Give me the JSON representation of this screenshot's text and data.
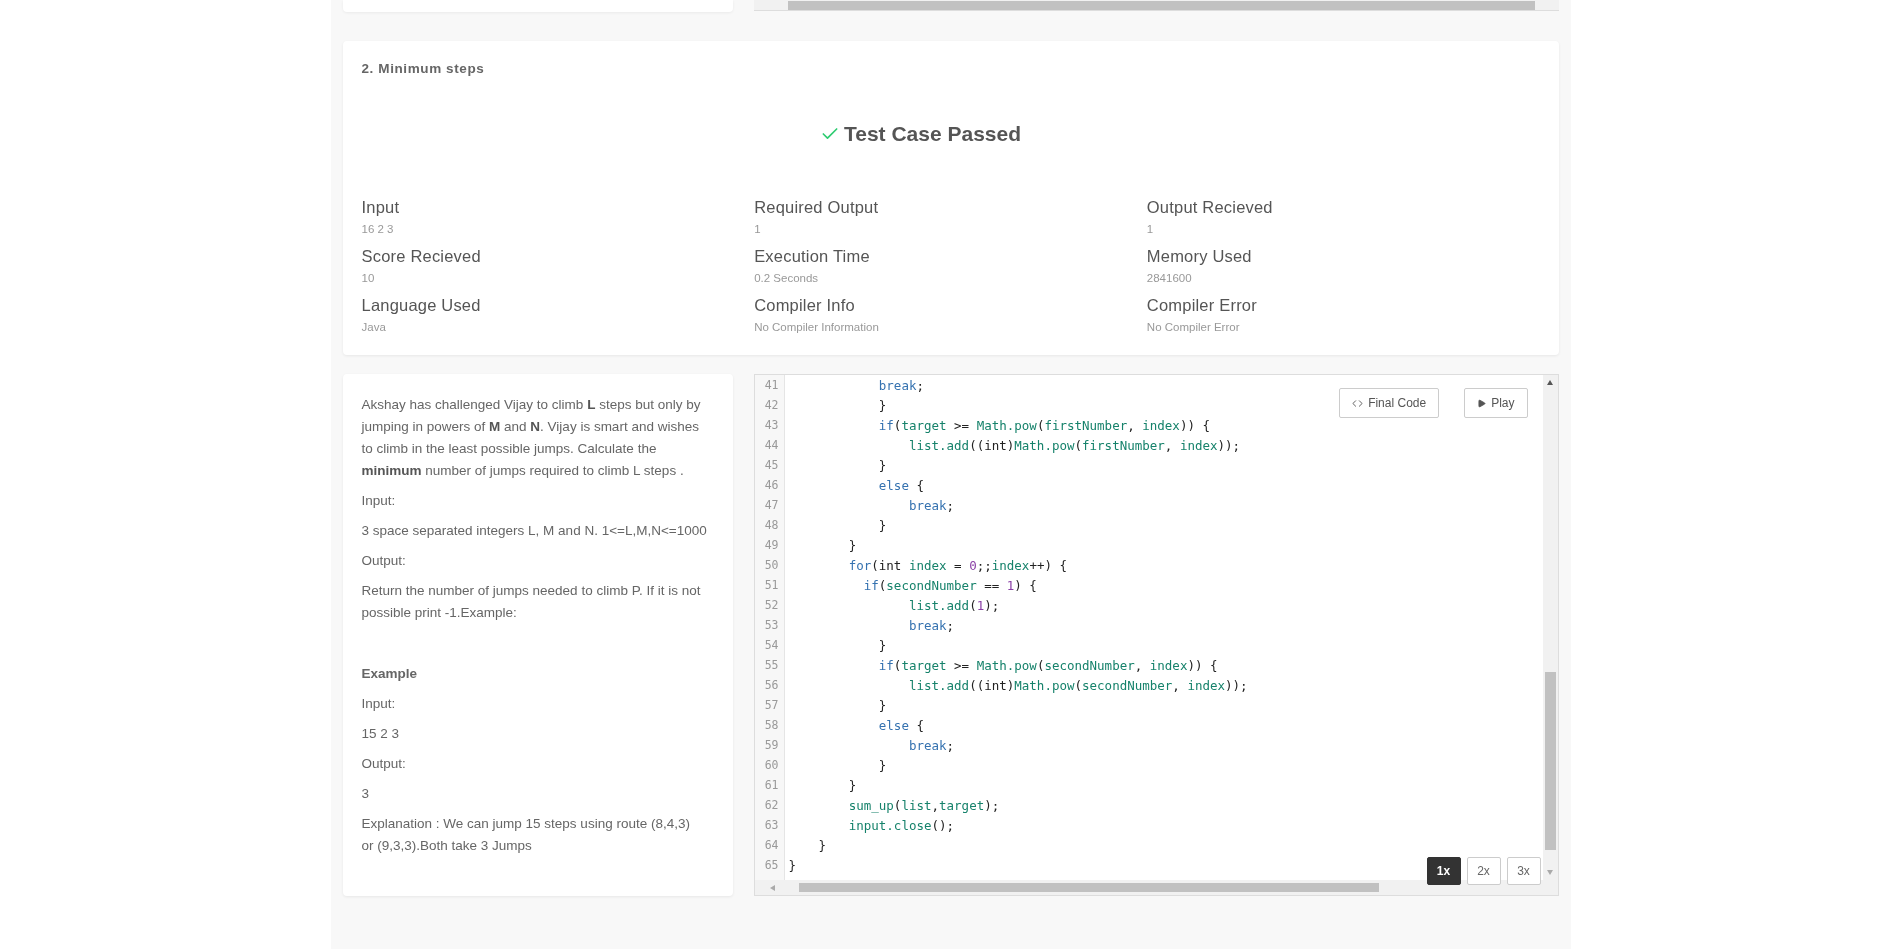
{
  "result": {
    "title": "2. Minimum steps",
    "status": {
      "text": "Test Case Passed",
      "passed": true
    },
    "fields": [
      {
        "label": "Input",
        "value": "16 2 3"
      },
      {
        "label": "Required Output",
        "value": "1"
      },
      {
        "label": "Output Recieved",
        "value": "1"
      },
      {
        "label": "Score Recieved",
        "value": "10"
      },
      {
        "label": "Execution Time",
        "value": "0.2 Seconds"
      },
      {
        "label": "Memory Used",
        "value": "2841600"
      },
      {
        "label": "Language Used",
        "value": "Java"
      },
      {
        "label": "Compiler Info",
        "value": "No Compiler Information"
      },
      {
        "label": "Compiler Error",
        "value": "No Compiler Error"
      }
    ]
  },
  "problem": {
    "paragraphs": [
      {
        "kind": "text",
        "text": "Akshay has challenged Vijay to climb **L** steps but only by jumping in powers of **M** and **N**. Vijay is smart and wishes to climb in the least possible jumps. Calculate the **minimum** number of jumps required to climb L steps ."
      },
      {
        "kind": "text",
        "text": "Input:"
      },
      {
        "kind": "text",
        "text": "3 space separated integers L, M and N. 1<=L,M,N<=1000"
      },
      {
        "kind": "text",
        "text": "Output:"
      },
      {
        "kind": "text",
        "text": "Return the number of jumps needed to climb P. If it is not possible print -1.Example:"
      },
      {
        "kind": "heading",
        "text": "Example"
      },
      {
        "kind": "text",
        "text": "Input:"
      },
      {
        "kind": "text",
        "text": "15 2 3"
      },
      {
        "kind": "text",
        "text": "Output:"
      },
      {
        "kind": "text",
        "text": "3"
      },
      {
        "kind": "text",
        "text": "Explanation : We can jump 15 steps using route (8,4,3)\n or (9,3,3).Both take 3 Jumps"
      }
    ]
  },
  "editor": {
    "buttons": [
      {
        "kind": "code",
        "label": "Final Code"
      },
      {
        "kind": "play",
        "label": "Play"
      }
    ],
    "speeds": [
      {
        "label": "1x",
        "selected": true
      },
      {
        "label": "2x",
        "selected": false
      },
      {
        "label": "3x",
        "selected": false
      }
    ],
    "lines": [
      {
        "number": "41",
        "tokens": [
          {
            "kind": "kw",
            "text": "            break"
          },
          {
            "kind": "p",
            "text": ";"
          }
        ]
      },
      {
        "number": "42",
        "tokens": [
          {
            "kind": "p",
            "text": "            }"
          }
        ]
      },
      {
        "number": "43",
        "tokens": [
          {
            "kind": "kw",
            "text": "            if"
          },
          {
            "kind": "p",
            "text": "("
          },
          {
            "kind": "id",
            "text": "target"
          },
          {
            "kind": "p",
            "text": " >= "
          },
          {
            "kind": "id",
            "text": "Math.pow"
          },
          {
            "kind": "p",
            "text": "("
          },
          {
            "kind": "id",
            "text": "firstNumber"
          },
          {
            "kind": "p",
            "text": ", "
          },
          {
            "kind": "id",
            "text": "index"
          },
          {
            "kind": "p",
            "text": ")) {"
          }
        ]
      },
      {
        "number": "44",
        "tokens": [
          {
            "kind": "id",
            "text": "                list.add"
          },
          {
            "kind": "p",
            "text": "((int)"
          },
          {
            "kind": "id",
            "text": "Math.pow"
          },
          {
            "kind": "p",
            "text": "("
          },
          {
            "kind": "id",
            "text": "firstNumber"
          },
          {
            "kind": "p",
            "text": ", "
          },
          {
            "kind": "id",
            "text": "index"
          },
          {
            "kind": "p",
            "text": "));"
          }
        ]
      },
      {
        "number": "45",
        "tokens": [
          {
            "kind": "p",
            "text": "            }"
          }
        ]
      },
      {
        "number": "46",
        "tokens": [
          {
            "kind": "kw",
            "text": "            else"
          },
          {
            "kind": "p",
            "text": " {"
          }
        ]
      },
      {
        "number": "47",
        "tokens": [
          {
            "kind": "kw",
            "text": "                break"
          },
          {
            "kind": "p",
            "text": ";"
          }
        ]
      },
      {
        "number": "48",
        "tokens": [
          {
            "kind": "p",
            "text": "            }"
          }
        ]
      },
      {
        "number": "49",
        "tokens": [
          {
            "kind": "p",
            "text": "        }"
          }
        ]
      },
      {
        "number": "50",
        "tokens": [
          {
            "kind": "kw",
            "text": "        for"
          },
          {
            "kind": "p",
            "text": "(int "
          },
          {
            "kind": "id",
            "text": "index"
          },
          {
            "kind": "p",
            "text": " = "
          },
          {
            "kind": "num",
            "text": "0"
          },
          {
            "kind": "p",
            "text": ";;"
          },
          {
            "kind": "id",
            "text": "index"
          },
          {
            "kind": "p",
            "text": "++) {"
          }
        ]
      },
      {
        "number": "51",
        "tokens": [
          {
            "kind": "kw",
            "text": "          if"
          },
          {
            "kind": "p",
            "text": "("
          },
          {
            "kind": "id",
            "text": "secondNumber"
          },
          {
            "kind": "p",
            "text": " == "
          },
          {
            "kind": "num",
            "text": "1"
          },
          {
            "kind": "p",
            "text": ") {"
          }
        ]
      },
      {
        "number": "52",
        "tokens": [
          {
            "kind": "id",
            "text": "                list.add"
          },
          {
            "kind": "p",
            "text": "("
          },
          {
            "kind": "num",
            "text": "1"
          },
          {
            "kind": "p",
            "text": ");"
          }
        ]
      },
      {
        "number": "53",
        "tokens": [
          {
            "kind": "kw",
            "text": "                break"
          },
          {
            "kind": "p",
            "text": ";"
          }
        ]
      },
      {
        "number": "54",
        "tokens": [
          {
            "kind": "p",
            "text": "            }"
          }
        ]
      },
      {
        "number": "55",
        "tokens": [
          {
            "kind": "kw",
            "text": "            if"
          },
          {
            "kind": "p",
            "text": "("
          },
          {
            "kind": "id",
            "text": "target"
          },
          {
            "kind": "p",
            "text": " >= "
          },
          {
            "kind": "id",
            "text": "Math.pow"
          },
          {
            "kind": "p",
            "text": "("
          },
          {
            "kind": "id",
            "text": "secondNumber"
          },
          {
            "kind": "p",
            "text": ", "
          },
          {
            "kind": "id",
            "text": "index"
          },
          {
            "kind": "p",
            "text": ")) {"
          }
        ]
      },
      {
        "number": "56",
        "tokens": [
          {
            "kind": "id",
            "text": "                list.add"
          },
          {
            "kind": "p",
            "text": "((int)"
          },
          {
            "kind": "id",
            "text": "Math.pow"
          },
          {
            "kind": "p",
            "text": "("
          },
          {
            "kind": "id",
            "text": "secondNumber"
          },
          {
            "kind": "p",
            "text": ", "
          },
          {
            "kind": "id",
            "text": "index"
          },
          {
            "kind": "p",
            "text": "));"
          }
        ]
      },
      {
        "number": "57",
        "tokens": [
          {
            "kind": "p",
            "text": "            }"
          }
        ]
      },
      {
        "number": "58",
        "tokens": [
          {
            "kind": "kw",
            "text": "            else"
          },
          {
            "kind": "p",
            "text": " {"
          }
        ]
      },
      {
        "number": "59",
        "tokens": [
          {
            "kind": "kw",
            "text": "                break"
          },
          {
            "kind": "p",
            "text": ";"
          }
        ]
      },
      {
        "number": "60",
        "tokens": [
          {
            "kind": "p",
            "text": "            }"
          }
        ]
      },
      {
        "number": "61",
        "tokens": [
          {
            "kind": "p",
            "text": "        }"
          }
        ]
      },
      {
        "number": "62",
        "tokens": [
          {
            "kind": "id",
            "text": "        sum_up"
          },
          {
            "kind": "p",
            "text": "("
          },
          {
            "kind": "id",
            "text": "list"
          },
          {
            "kind": "p",
            "text": ","
          },
          {
            "kind": "id",
            "text": "target"
          },
          {
            "kind": "p",
            "text": ");"
          }
        ]
      },
      {
        "number": "63",
        "tokens": [
          {
            "kind": "id",
            "text": "        input.close"
          },
          {
            "kind": "p",
            "text": "();"
          }
        ]
      },
      {
        "number": "64",
        "tokens": [
          {
            "kind": "p",
            "text": "    }"
          }
        ]
      },
      {
        "number": "65",
        "tokens": [
          {
            "kind": "p",
            "text": "}"
          }
        ]
      }
    ]
  }
}
